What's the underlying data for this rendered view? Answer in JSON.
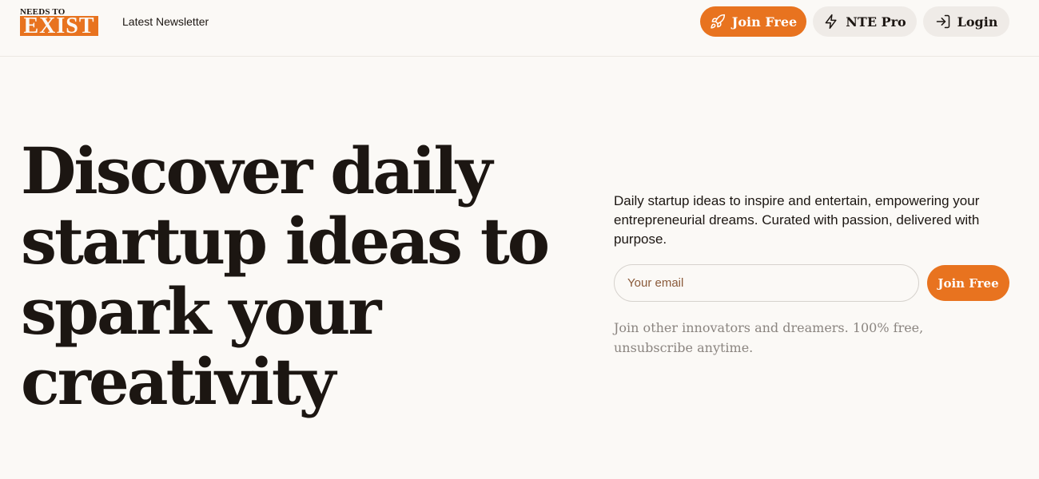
{
  "brand": {
    "logo_top": "NEEDS TO",
    "logo_bottom": "EXIST",
    "accent_color": "#e8731f"
  },
  "header": {
    "nav_link": "Latest Newsletter",
    "join_label": "Join Free",
    "join_icon": "rocket-icon",
    "pro_label": "NTE Pro",
    "pro_icon": "lightning-icon",
    "login_label": "Login",
    "login_icon": "login-icon"
  },
  "hero": {
    "title": "Discover daily startup ideas to spark your creativity",
    "tagline": "Daily startup ideas to inspire and entertain, empowering your entrepreneurial dreams.  Curated with passion, delivered with purpose.",
    "email_placeholder": "Your email",
    "email_value": "",
    "submit_label": "Join Free",
    "fineprint": "Join other innovators and dreamers. 100% free, unsubscribe anytime."
  }
}
